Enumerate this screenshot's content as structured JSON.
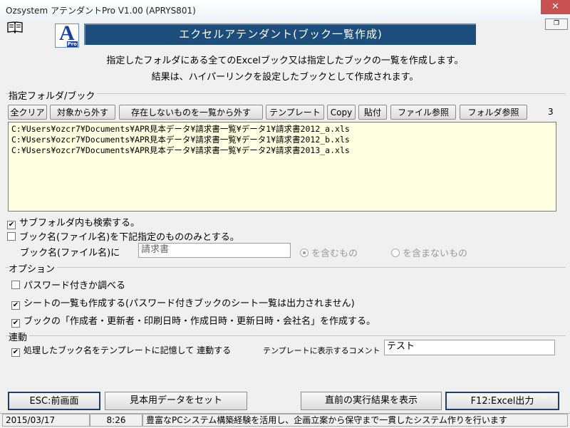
{
  "window": {
    "title": "Ozsystem アテンダントPro V1.00 (APRYS801)",
    "close": "✕"
  },
  "header": {
    "logo_letter": "A",
    "logo_tag": "Pro",
    "banner": "エクセルアテンダント(ブック一覧作成)",
    "desc_line1": "指定したフォルダにある全てのExcelブック又は指定したブックの一覧を作成します。",
    "desc_line2": "結果は、ハイパーリンクを設定したブックとして作成されます。"
  },
  "folder_section": {
    "label": "指定フォルダ/ブック",
    "buttons": [
      "全クリア",
      "対象から外す",
      "存在しないものを一覧から外す",
      "テンプレート",
      "Copy",
      "貼付",
      "ファイル参照",
      "フォルダ参照"
    ],
    "count": "3",
    "files": [
      "C:¥Users¥ozcr7¥Documents¥APR見本データ¥請求書一覧¥データ1¥請求書2012_a.xls",
      "C:¥Users¥ozcr7¥Documents¥APR見本データ¥請求書一覧¥データ1¥請求書2012_b.xls",
      "C:¥Users¥ozcr7¥Documents¥APR見本データ¥請求書一覧¥データ2¥請求書2013_a.xls"
    ],
    "subfolder_label": "サブフォルダ内も検索する。",
    "subfolder_checked": true,
    "bookname_only_label": "ブック名(ファイル名)を下記指定のもののみとする。",
    "bookname_only_checked": false,
    "bookname_label": "ブック名(ファイル名)に",
    "bookname_value": "請求書",
    "radio_include": "を含むもの",
    "radio_exclude": "を含まないもの"
  },
  "options": {
    "label": "オプション",
    "items": [
      {
        "label": "パスワード付きか調べる",
        "checked": false
      },
      {
        "label": "シートの一覧も作成する(パスワード付きブックのシート一覧は出力されません)",
        "checked": true
      },
      {
        "label": "ブックの「作成者・更新者・印刷日時・作成日時・更新日時・会社名」を作成する。",
        "checked": true
      }
    ]
  },
  "link": {
    "label": "連動",
    "checkbox_label": "処理したブック名をテンプレートに記憶して 連動する",
    "checked": true,
    "comment_label": "テンプレートに表示するコメント",
    "comment_value": "テスト"
  },
  "footer_buttons": {
    "esc": "ESC:前画面",
    "sample": "見本用データをセット",
    "last_result": "直前の実行結果を表示",
    "excel": "F12:Excel出力"
  },
  "status": {
    "date": "2015/03/17",
    "time": "8:26",
    "message": "豊富なPCシステム構築経験を活用し、企画立案から保守まで一貫したシステム作りを行います"
  },
  "icons": {
    "book": "book-icon",
    "check": "✔"
  }
}
